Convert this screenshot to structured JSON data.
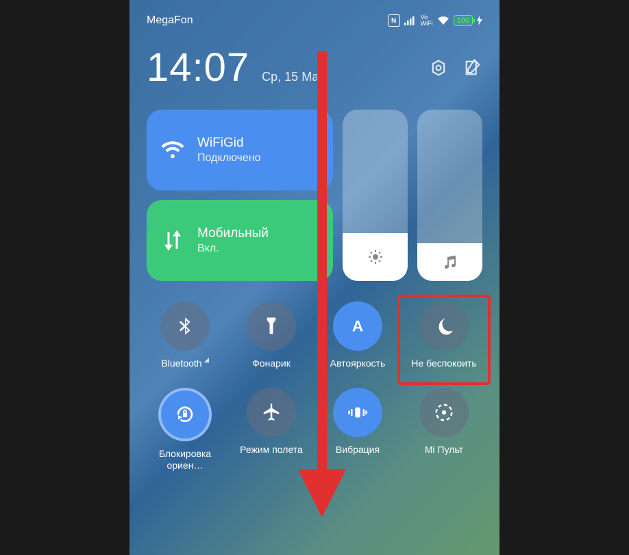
{
  "status": {
    "carrier": "MegaFon",
    "battery": "100"
  },
  "time": "14:07",
  "date": "Ср, 15 Май",
  "wifi": {
    "title": "WiFiGid",
    "sub": "Подключено"
  },
  "mobile": {
    "title": "Мобильный",
    "sub": "Вкл."
  },
  "toggles": {
    "bluetooth": "Bluetooth",
    "flashlight": "Фонарик",
    "autobright": "Автояркость",
    "dnd": "Не беспокоить",
    "rotation": "Блокировка ориен…",
    "airplane": "Режим полета",
    "vibration": "Вибрация",
    "remote": "Mi Пульт"
  }
}
